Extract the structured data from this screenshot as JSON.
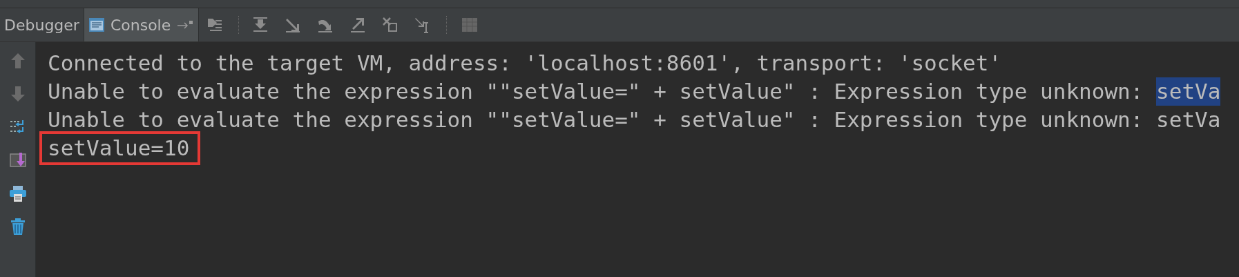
{
  "tabs": [
    {
      "label": "Debugger",
      "selected": false
    },
    {
      "label": "Console",
      "selected": true
    }
  ],
  "console": {
    "lines": [
      {
        "boxed": false,
        "segments": [
          {
            "text": "Connected to the target VM, address: 'localhost:8601', transport: 'socket'",
            "selected": false
          }
        ]
      },
      {
        "boxed": false,
        "segments": [
          {
            "text": "Unable to evaluate the expression \"\"setValue=\" + setValue\" : Expression type unknown: ",
            "selected": false
          },
          {
            "text": "setVa",
            "selected": true
          }
        ]
      },
      {
        "boxed": false,
        "segments": [
          {
            "text": "Unable to evaluate the expression \"\"setValue=\" + setValue\" : Expression type unknown: setVa",
            "selected": false
          }
        ]
      },
      {
        "boxed": true,
        "segments": [
          {
            "text": "setValue=10",
            "selected": false
          }
        ]
      }
    ]
  }
}
